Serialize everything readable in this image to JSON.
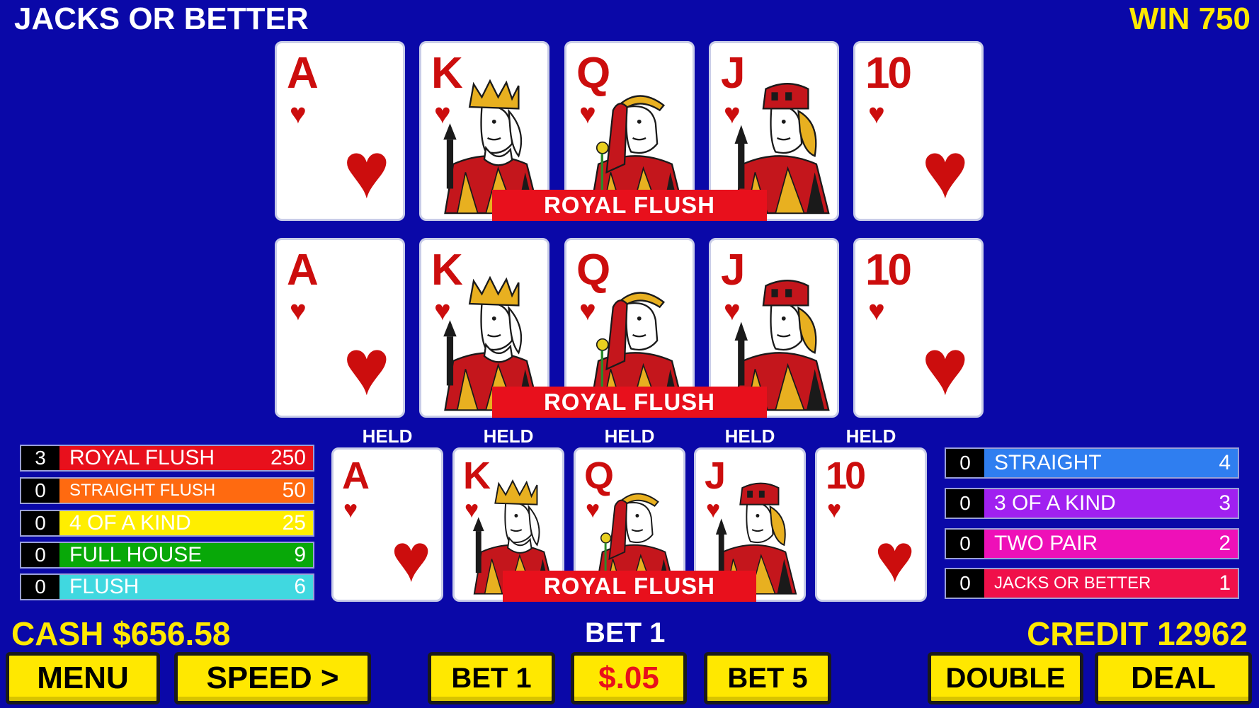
{
  "header": {
    "title": "JACKS OR BETTER",
    "win": "WIN 750"
  },
  "hands": {
    "top": {
      "banner": "ROYAL FLUSH",
      "cards": [
        {
          "rank": "A",
          "suit": "♥",
          "face": false
        },
        {
          "rank": "K",
          "suit": "♥",
          "face": "king"
        },
        {
          "rank": "Q",
          "suit": "♥",
          "face": "queen"
        },
        {
          "rank": "J",
          "suit": "♥",
          "face": "jack"
        },
        {
          "rank": "10",
          "suit": "♥",
          "face": false
        }
      ]
    },
    "middle": {
      "banner": "ROYAL FLUSH"
    },
    "bottom": {
      "banner": "ROYAL FLUSH"
    }
  },
  "held_label": "HELD",
  "cards": [
    "A",
    "K",
    "Q",
    "J",
    "10"
  ],
  "suit_symbol": "♥",
  "paytable_left": [
    {
      "count": "0",
      "name": "STRAIGHT FLUSH",
      "pay": "50",
      "color": "#ff6a10"
    },
    {
      "count": "0",
      "name": "4 OF A KIND",
      "pay": "25",
      "color": "#ffee00"
    },
    {
      "count": "0",
      "name": "FULL HOUSE",
      "pay": "9",
      "color": "#08a808"
    },
    {
      "count": "0",
      "name": "FLUSH",
      "pay": "6",
      "color": "#40d8e0"
    }
  ],
  "paytable_top": {
    "count": "3",
    "name": "ROYAL FLUSH",
    "pay": "250",
    "color": "#e8101c"
  },
  "paytable_right": [
    {
      "count": "0",
      "name": "STRAIGHT",
      "pay": "4",
      "color": "#2f7ef0"
    },
    {
      "count": "0",
      "name": "3 OF A KIND",
      "pay": "3",
      "color": "#a020f0"
    },
    {
      "count": "0",
      "name": "TWO PAIR",
      "pay": "2",
      "color": "#ee10b8"
    },
    {
      "count": "0",
      "name": "JACKS OR BETTER",
      "pay": "1",
      "color": "#f0104a"
    }
  ],
  "status": {
    "cash": "CASH $656.58",
    "bet": "BET 1",
    "credit": "CREDIT 12962"
  },
  "buttons": {
    "menu": "MENU",
    "speed": "SPEED >",
    "bet1": "BET 1",
    "denom": "$.05",
    "bet5": "BET 5",
    "double": "DOUBLE",
    "deal": "DEAL"
  },
  "colors": {
    "background": "#0a08a8",
    "accent": "#ffe800",
    "card_red": "#cc0d0d",
    "banner": "#e8101c"
  }
}
